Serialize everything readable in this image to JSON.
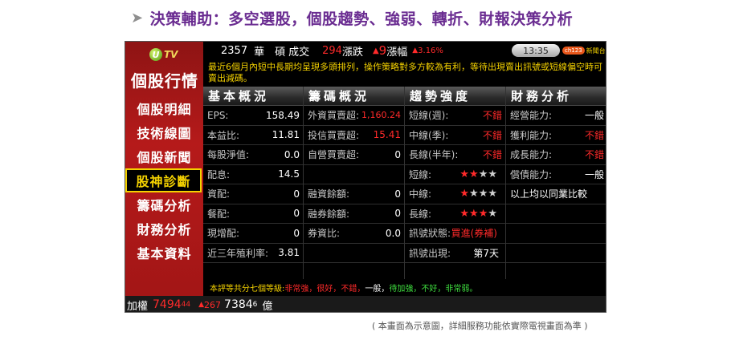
{
  "headline": "決策輔助：多空選股，個股趨勢、強弱、轉折、財報決策分析",
  "side": {
    "logo_letter": "U",
    "logo_text": "TV",
    "title": "個股行情",
    "items": [
      {
        "label": "個股明細"
      },
      {
        "label": "技術線圖"
      },
      {
        "label": "個股新聞"
      },
      {
        "label": "股神診斷"
      },
      {
        "label": "籌碼分析"
      },
      {
        "label": "財務分析"
      },
      {
        "label": "基本資料"
      }
    ]
  },
  "topbar": {
    "code": "2357",
    "name": "華　碩",
    "vol_label": "成交",
    "change_num": "294",
    "change_label": "漲跌",
    "change_arrow": "▲",
    "change_val": "9",
    "pct_label": "漲幅",
    "pct_arrow": "▲",
    "pct_val": "3.16%",
    "time": "13:35",
    "brand_pill": "ch123",
    "brand_text": "新聞台"
  },
  "notice": "最近6個月內短中長期均呈現多頭排列，操作策略對多方較為有利，等待出現賣出訊號或短線偏空時可賣出減碼。",
  "sections": {
    "basic": {
      "title": "基本概況",
      "rows": [
        {
          "label": "EPS:",
          "value": "158.49"
        },
        {
          "label": "本益比:",
          "value": "11.81"
        },
        {
          "label": "每股淨值:",
          "value": "0.0"
        },
        {
          "label": "配息:",
          "value": "14.5"
        },
        {
          "label": "資配:",
          "value": "0"
        },
        {
          "label": "餐配:",
          "value": "0"
        },
        {
          "label": "現增配:",
          "value": "0"
        },
        {
          "label": "近三年殖利率:",
          "value": "3.81"
        }
      ]
    },
    "chips": {
      "title": "籌碼概況",
      "rows": [
        {
          "label": "外資買賣超:",
          "value": "1,160.24"
        },
        {
          "label": "投信買賣超:",
          "value": "15.41"
        },
        {
          "label": "自營買賣超:",
          "value": "0"
        },
        {
          "label": "",
          "value": ""
        },
        {
          "label": "融資餘額:",
          "value": "0"
        },
        {
          "label": "融券餘額:",
          "value": "0"
        },
        {
          "label": "券資比:",
          "value": "0.0"
        },
        {
          "label": "",
          "value": ""
        }
      ]
    },
    "trend": {
      "title": "趨勢強度",
      "rows": [
        {
          "label": "短線(週):",
          "value": "不錯"
        },
        {
          "label": "中線(季):",
          "value": "不錯"
        },
        {
          "label": "長線(半年):",
          "value": "不錯"
        },
        {
          "label": "短線:",
          "stars_on": 2,
          "stars_total": 4
        },
        {
          "label": "中線:",
          "stars_on": 1,
          "stars_total": 4
        },
        {
          "label": "長線:",
          "stars_on": 3,
          "stars_total": 4
        },
        {
          "label": "訊號狀態:",
          "value": "買進(券補)"
        },
        {
          "label": "訊號出現:",
          "value": "第7天"
        }
      ]
    },
    "finance": {
      "title": "財務分析",
      "rows": [
        {
          "label": "經營能力:",
          "value": "一般"
        },
        {
          "label": "獲利能力:",
          "value": "不錯"
        },
        {
          "label": "成長能力:",
          "value": "不錯"
        },
        {
          "label": "償債能力:",
          "value": "一般"
        },
        {
          "label": "以上均以同業比較",
          "value": ""
        },
        {
          "label": "",
          "value": ""
        },
        {
          "label": "",
          "value": ""
        },
        {
          "label": "",
          "value": ""
        }
      ]
    }
  },
  "footer_note": {
    "prefix": "本評等共分七個等級:",
    "red_part": "非常強，很好，不錯，",
    "white_part": "一般，",
    "green_part": "待加強，不好，非常弱。"
  },
  "ticker": {
    "label": "加權",
    "index_main": "7494",
    "index_dec": "44",
    "arrow": "▲",
    "change": "267",
    "amount_main": "7384",
    "amount_dec": "6",
    "amount_unit": "億"
  },
  "caption": "( 本畫面為示意圖，詳細服務功能依實際電視畫面為準 )",
  "colors": {
    "headline": "#6a2c91",
    "sidebar": "#b51a1a",
    "highlight": "#f5d200",
    "up": "#ff2a2a",
    "down": "#3fe03f"
  }
}
